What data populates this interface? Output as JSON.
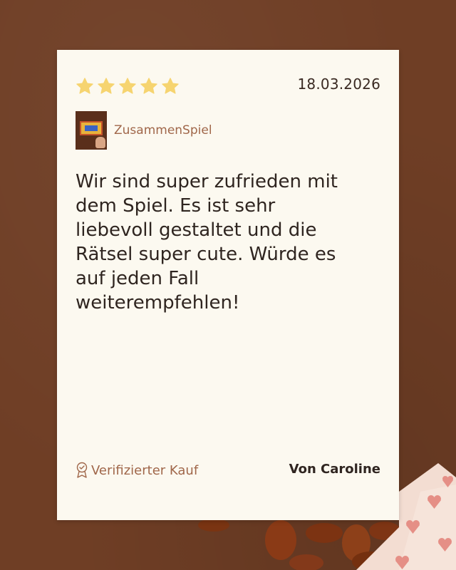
{
  "review": {
    "rating": 5,
    "rating_max": 5,
    "date": "18.03.2026",
    "product_name": "ZusammenSpiel",
    "text": "Wir sind super zufrieden mit\ndem Spiel. Es ist sehr\nliebevoll gestaltet  und die\nRätsel super cute. Würde es\nauf jeden Fall\nweiterempfehlen!",
    "verified_label": "Verifizierter Kauf",
    "author": "Von Caroline"
  },
  "icons": {
    "rating": "star-icon",
    "verified": "award-badge-icon"
  },
  "colors": {
    "background": "#6f3e25",
    "card": "#fcf9f0",
    "star": "#f6d470",
    "accent_text": "#a0674a",
    "body_text": "#2f2520"
  }
}
